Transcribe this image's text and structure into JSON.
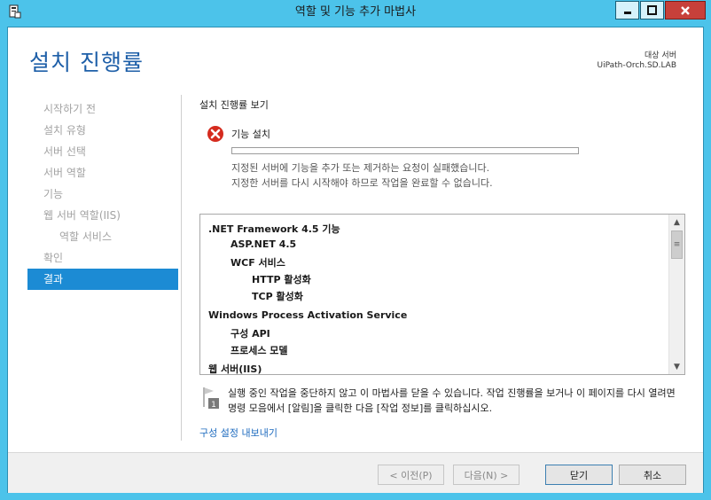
{
  "window": {
    "title": "역할 및 기능 추가 마법사",
    "colors": {
      "frame": "#4cc3ea",
      "accent": "#1c8bd4",
      "title_text": "#1e5fa8",
      "close": "#c7403a"
    }
  },
  "header": {
    "title": "설치 진행률",
    "destination_label": "대상 서버",
    "destination_server": "UiPath-Orch.SD.LAB"
  },
  "nav": {
    "items": [
      {
        "label": "시작하기 전"
      },
      {
        "label": "설치 유형"
      },
      {
        "label": "서버 선택"
      },
      {
        "label": "서버 역할"
      },
      {
        "label": "기능"
      },
      {
        "label": "웹 서버 역할(IIS)"
      },
      {
        "label": "역할 서비스"
      },
      {
        "label": "확인"
      },
      {
        "label": "결과"
      }
    ],
    "active_index": 8
  },
  "main": {
    "section_heading": "설치 진행률 보기",
    "status_icon": "error-icon",
    "feature_label": "기능 설치",
    "progress": 0,
    "message_line1": "지정된 서버에 기능을 추가 또는 제거하는 요청이 실패했습니다.",
    "message_line2": "지정한 서버를 다시 시작해야 하므로 작업을 완료할 수 없습니다.",
    "features": [
      {
        "label": ".NET Framework 4.5 기능"
      },
      {
        "label": "ASP.NET 4.5"
      },
      {
        "label": "WCF 서비스"
      },
      {
        "label": "HTTP 활성화"
      },
      {
        "label": "TCP 활성화"
      },
      {
        "label": "Windows Process Activation Service"
      },
      {
        "label": "구성 API"
      },
      {
        "label": "프로세스 모델"
      },
      {
        "label": "웹 서버(IIS)"
      }
    ],
    "note": "실행 중인 작업을 중단하지 않고 이 마법사를 닫을 수 있습니다. 작업 진행률을 보거나 이 페이지를 다시 열려면 명령 모음에서 [알림]을 클릭한 다음 [작업 정보]를 클릭하십시오.",
    "note_badge": "1",
    "export_link": "구성 설정 내보내기"
  },
  "footer": {
    "prev_label": "< 이전(P)",
    "next_label": "다음(N) >",
    "close_label": "닫기",
    "cancel_label": "취소"
  }
}
